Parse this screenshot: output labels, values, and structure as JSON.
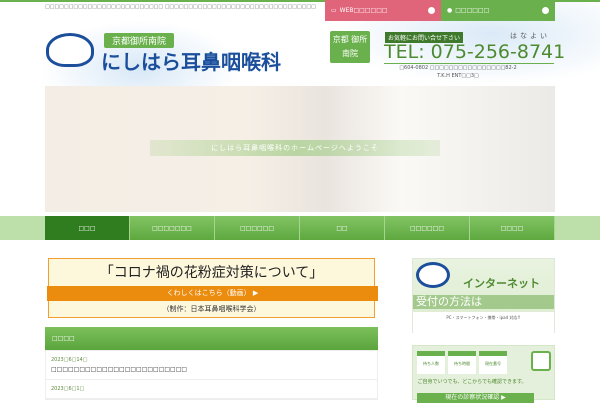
{
  "header": {
    "tagline": "□□□□□□□□□□□□□□□□□□□□□□□□□ □□□□□□□□□□□□□□□□□□□□□□□□□□□□□□□□",
    "web_button": "WEB□□□□□□",
    "access_button": "□□□□□□",
    "logo_sub": "京都御所南院",
    "logo_main": "にしはら耳鼻咽喉科",
    "area_badge": "京都 御所南院",
    "contact_label": "お気軽にお問い合せ下さい",
    "hanayoi": "はなよい",
    "tel": "TEL: 075-256-8741",
    "address_line1": "□604-0802 □□□□□□□□□□□□□□□□82-2",
    "address_line2": "T.K.H ENT□□3□"
  },
  "hero": {
    "caption": "にしはら耳鼻咽喉科のホームページへようこそ"
  },
  "nav": {
    "items": [
      "□□□",
      "□□□□□□□",
      "□□□□□□",
      "□□",
      "□□□□□□",
      "□□□□"
    ]
  },
  "banner": {
    "title": "「コロナ禍の花粉症対策について」",
    "link": "くわしくはこちら（動画） ▶",
    "credit": "（制作：日本耳鼻咽喉科学会）"
  },
  "news": {
    "heading": "□□□□",
    "items": [
      {
        "date": "2023□6□14□",
        "title": "□□□□□□□□□□□□□□□□□□□□□□□□"
      },
      {
        "date": "2023□6□1□",
        "title": ""
      }
    ]
  },
  "sidebar": {
    "internet": "インターネット",
    "howto": "受付の方法は",
    "devices": "PC・スマートフォン・携帯・ipad 対応!!",
    "wait_boxes": [
      "待ち人数",
      "待ち時間",
      "現在番号"
    ],
    "anywhere": "ご自身でいつでも、どこからでも確認できます。",
    "status_button": "現在の診察状況確認 ▶"
  }
}
